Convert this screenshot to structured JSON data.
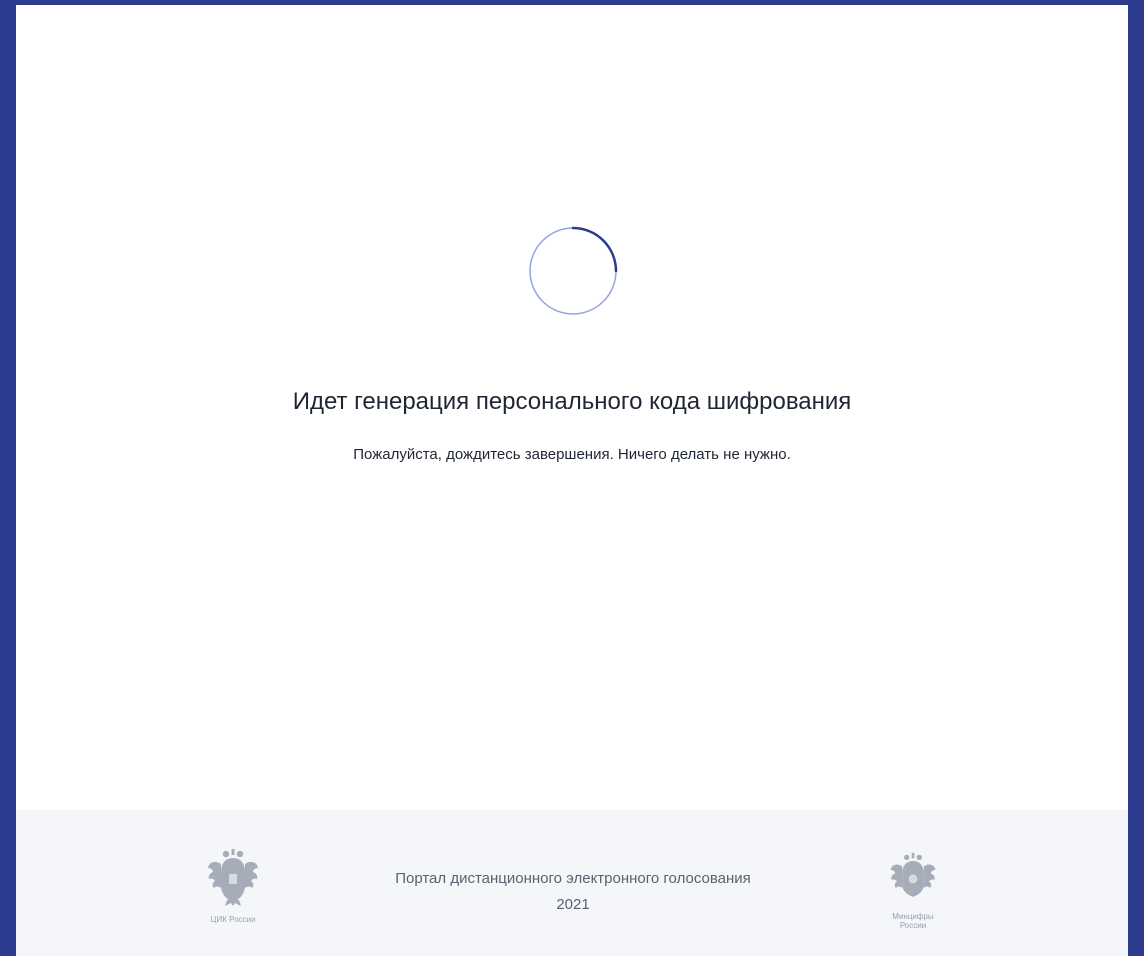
{
  "main": {
    "title": "Идет генерация персонального кода шифрования",
    "subtitle": "Пожалуйста, дождитесь завершения. Ничего делать не нужно."
  },
  "spinner": {
    "icon": "loading-spinner-icon",
    "colors": {
      "track": "#6f86d6",
      "arc": "#2c3b8e"
    }
  },
  "footer": {
    "portal_name": "Портал дистанционного электронного голосования",
    "year": "2021",
    "left_emblem": {
      "icon": "coat-of-arms-icon",
      "caption": "ЦИК России"
    },
    "right_emblem": {
      "icon": "coat-of-arms-icon",
      "caption_line1": "Минцифры",
      "caption_line2": "России"
    }
  },
  "colors": {
    "frame": "#2c3b8e",
    "panel": "#ffffff",
    "footer_bg": "#f4f6f9",
    "text_dark": "#1f2633",
    "text_muted": "#5a6170",
    "emblem": "#9aa1ad"
  }
}
